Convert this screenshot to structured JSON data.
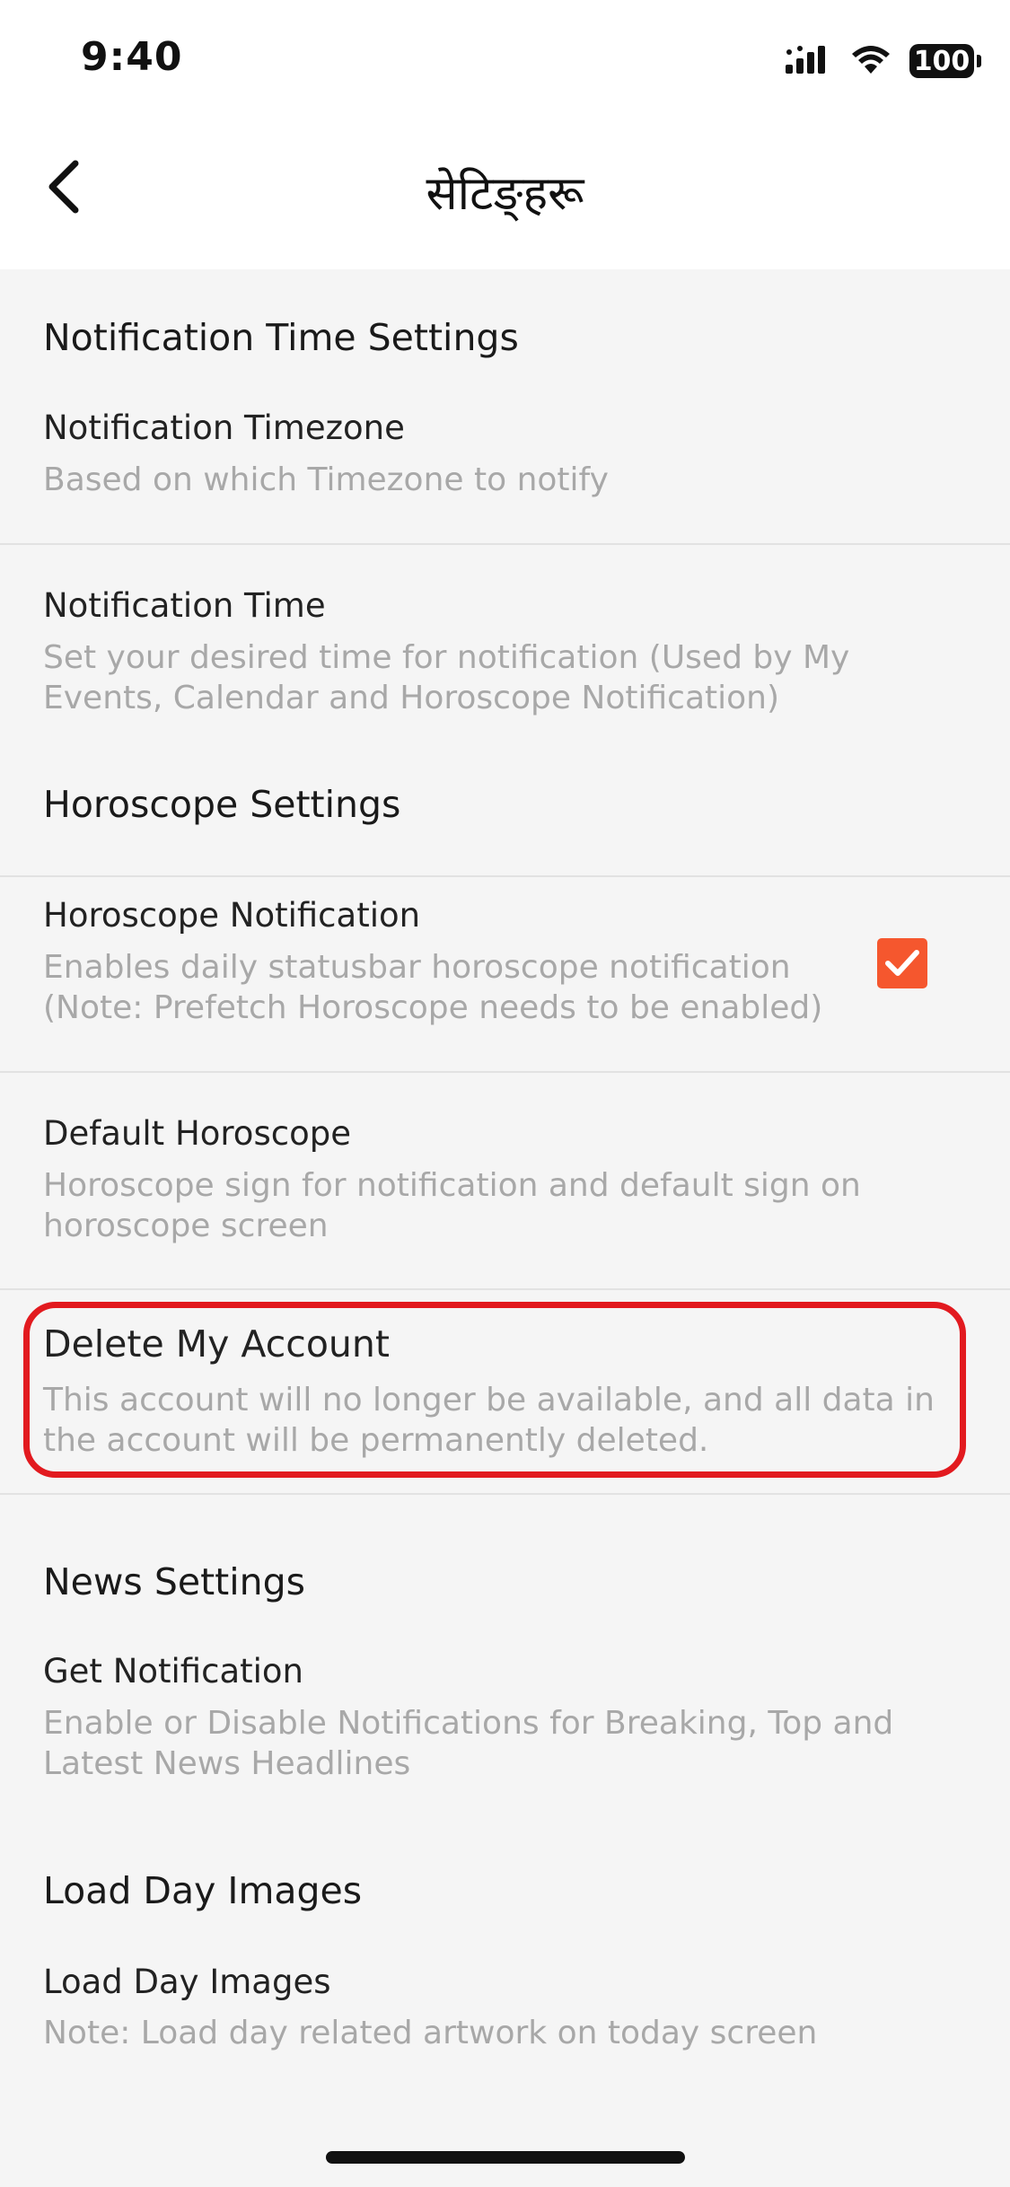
{
  "status_bar": {
    "time": "9:40",
    "battery": "100",
    "icons": [
      "signal-icon",
      "wifi-icon",
      "battery-icon"
    ]
  },
  "header": {
    "title": "सेटिङ्हरू",
    "back_icon": "chevron-left-icon"
  },
  "sections": {
    "notification_time": {
      "title": "Notification Time Settings",
      "timezone": {
        "title": "Notification Timezone",
        "subtitle": "Based on which Timezone to notify"
      },
      "time": {
        "title": "Notification Time",
        "subtitle": "Set your desired time for notification (Used by My Events, Calendar and Horoscope Notification)"
      }
    },
    "horoscope": {
      "title": "Horoscope Settings",
      "notification": {
        "title": "Horoscope Notification",
        "subtitle": "Enables daily statusbar horoscope notification (Note: Prefetch Horoscope needs to be enabled)",
        "checked": true
      },
      "default": {
        "title": "Default Horoscope",
        "subtitle": "Horoscope sign for notification and default sign on horoscope screen"
      },
      "delete_account": {
        "title": "Delete My Account",
        "subtitle": "This account will no longer be available, and all data in the account will be permanently deleted."
      }
    },
    "news": {
      "title": "News Settings",
      "get_notification": {
        "title": "Get Notification",
        "subtitle": "Enable or Disable Notifications for Breaking, Top and Latest News Headlines"
      }
    },
    "day_images": {
      "title": "Load Day Images",
      "item": {
        "title": "Load Day Images",
        "subtitle": "Note: Load day related artwork on today screen"
      }
    }
  },
  "colors": {
    "accent": "#f5572e",
    "highlight": "#e21a1f",
    "background": "#f5f5f5",
    "subtitle": "#a8a8a8"
  }
}
